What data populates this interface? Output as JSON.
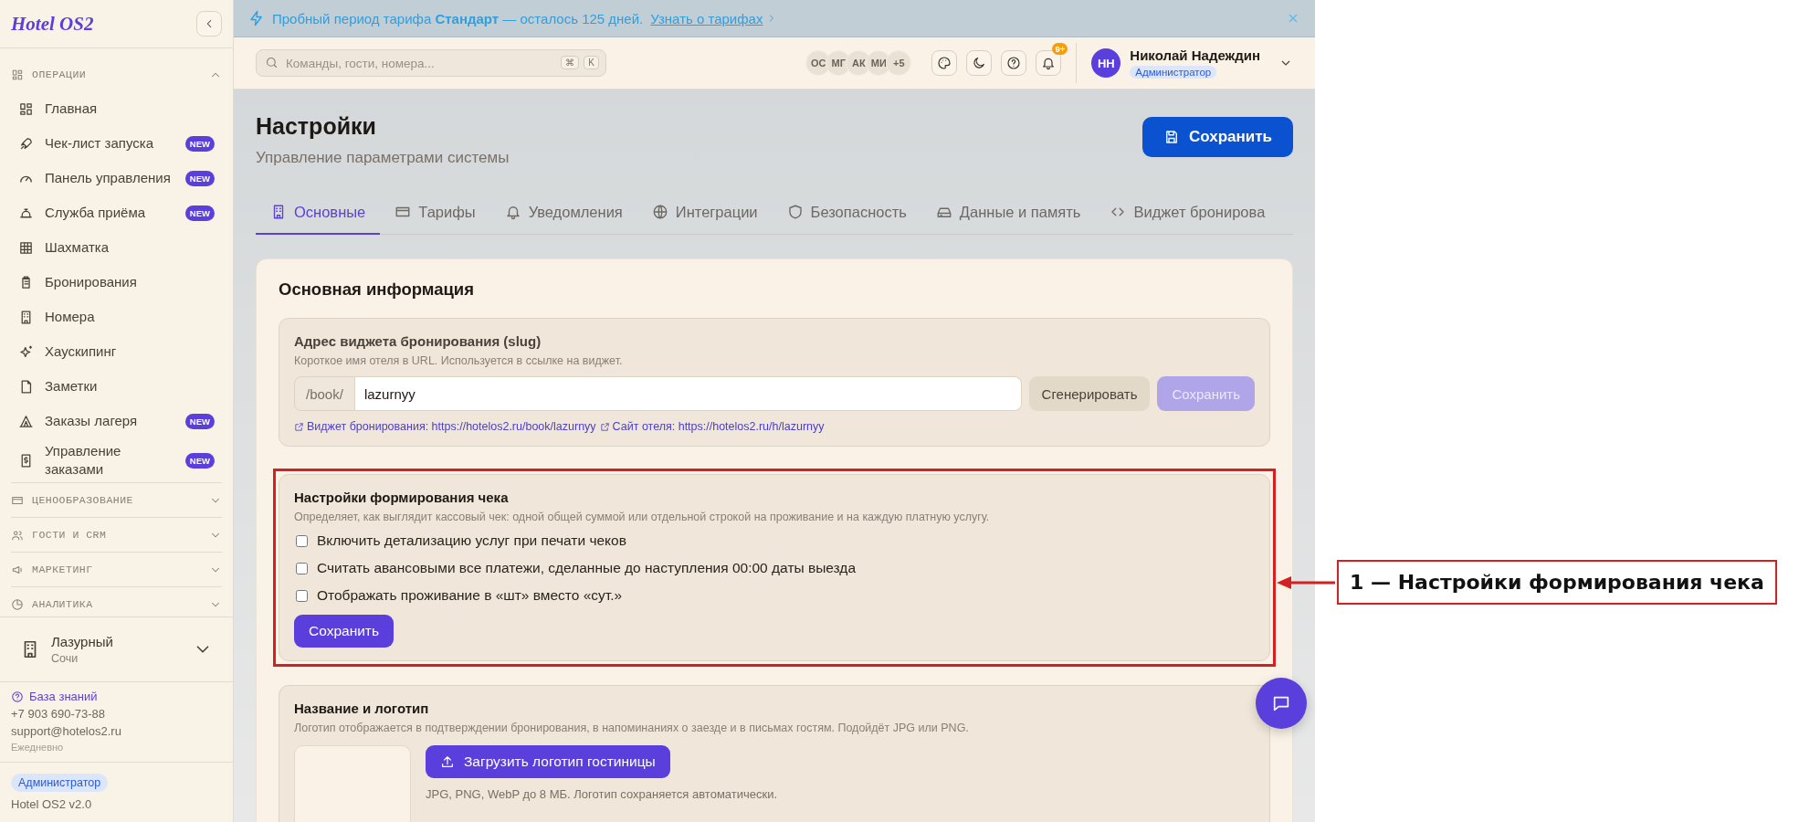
{
  "sidebar": {
    "logo": "Hotel OS2",
    "groups": [
      {
        "label": "ОПЕРАЦИИ",
        "expanded": true,
        "items": [
          {
            "label": "Главная",
            "selected": false
          },
          {
            "label": "Чек-лист запуска",
            "badge": "NEW",
            "selected": false
          },
          {
            "label": "Панель управления",
            "badge": "NEW",
            "selected": false
          },
          {
            "label": "Служба приёма",
            "badge": "NEW",
            "selected": false
          },
          {
            "label": "Шахматка",
            "selected": false
          },
          {
            "label": "Бронирования",
            "selected": false
          },
          {
            "label": "Номера",
            "selected": false
          },
          {
            "label": "Хаускипинг",
            "selected": false
          },
          {
            "label": "Заметки",
            "selected": false
          },
          {
            "label": "Заказы лагеря",
            "badge": "NEW",
            "selected": false
          },
          {
            "label": "Управление заказами",
            "badge": "NEW",
            "selected": false
          }
        ]
      },
      {
        "label": "ЦЕНООБРАЗОВАНИЕ",
        "expanded": false
      },
      {
        "label": "ГОСТИ И CRM",
        "expanded": false
      },
      {
        "label": "МАРКЕТИНГ",
        "expanded": false
      },
      {
        "label": "АНАЛИТИКА",
        "expanded": false
      }
    ],
    "hotel": {
      "name": "Лазурный",
      "city": "Сочи"
    },
    "support": {
      "link": "База знаний",
      "phone": "+7 903 690-73-88",
      "email": "support@hotelos2.ru",
      "hours": "Ежедневно"
    },
    "footer": {
      "role": "Администратор",
      "version": "Hotel OS2 v2.0"
    }
  },
  "banner": {
    "text": "Пробный период тарифа **Стандарт** — осталось 125 дней.",
    "link": "Узнать о тарифах"
  },
  "topbar": {
    "search": {
      "placeholder": "Команды, гости, номера...",
      "keys": [
        "⌘",
        "K"
      ]
    },
    "avatars": [
      "ОС",
      "МГ",
      "АК",
      "МИ"
    ],
    "more": "+5",
    "notification_count": "9+",
    "user": {
      "initials": "НН",
      "name": "Николай Надеждин",
      "role": "Администратор"
    }
  },
  "page": {
    "title": "Настройки",
    "subtitle": "Управление параметрами системы",
    "save": "Сохранить",
    "tabs": [
      {
        "label": "Основные",
        "selected": true
      },
      {
        "label": "Тарифы",
        "selected": false
      },
      {
        "label": "Уведомления",
        "selected": false
      },
      {
        "label": "Интеграции",
        "selected": false
      },
      {
        "label": "Безопасность",
        "selected": false
      },
      {
        "label": "Данные и память",
        "selected": false
      },
      {
        "label": "Виджет бронирова",
        "selected": false
      }
    ]
  },
  "card": {
    "title": "Основная информация",
    "slug": {
      "title": "Адрес виджета бронирования (slug)",
      "description": "Короткое имя отеля в URL. Используется в ссылке на виджет.",
      "prefix": "/book/",
      "value": "lazurnyy",
      "generate": "Сгенерировать",
      "save": "Сохранить",
      "save_disabled": true,
      "links": [
        "Виджет бронирования: https://hotelos2.ru/book/lazurnyy",
        "Сайт отеля: https://hotelos2.ru/h/lazurnyy"
      ]
    },
    "receipt": {
      "title": "Настройки формирования чека",
      "description": "Определяет, как выглядит кассовый чек: одной общей суммой или отдельной строкой на проживание и на каждую платную услугу.",
      "options": [
        {
          "label": "Включить детализацию услуг при печати чеков",
          "checked": false
        },
        {
          "label": "Считать авансовыми все платежи, сделанные до наступления 00:00 даты выезда",
          "checked": false
        },
        {
          "label": "Отображать проживание в «шт» вместо «сут.»",
          "checked": false
        }
      ],
      "save": "Сохранить"
    },
    "logo": {
      "title": "Название и логотип",
      "description": "Логотип отображается в подтверждении бронирования, в напоминаниях о заезде и в письмах гостям. Подойдёт JPG или PNG.",
      "upload": "Загрузить логотип гостиницы",
      "hint": "JPG, PNG, WebP до 8 МБ. Логотип сохраняется автоматически."
    }
  },
  "annotation": {
    "label": "1 — Настройки формирования чека"
  }
}
